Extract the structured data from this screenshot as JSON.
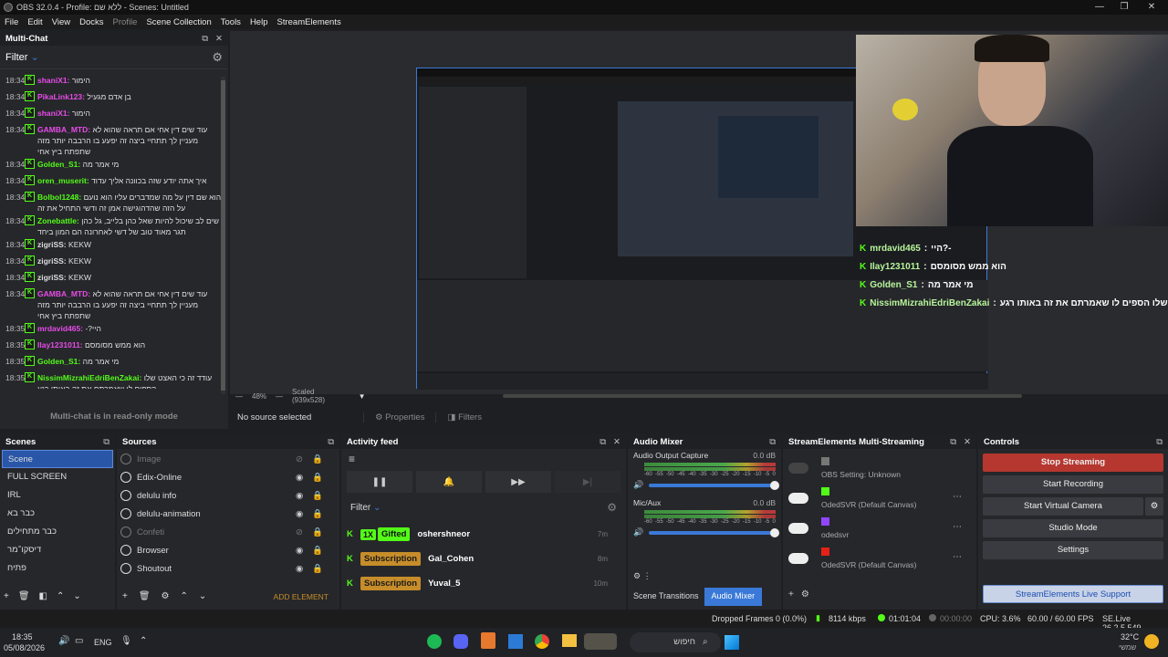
{
  "window": {
    "title": "OBS 32.0.4 - Profile: ללא שם - Scenes: Untitled",
    "min": "—",
    "max": "❐",
    "close": "✕"
  },
  "menu": [
    "File",
    "Edit",
    "View",
    "Docks",
    "Profile",
    "Scene Collection",
    "Tools",
    "Help",
    "StreamElements"
  ],
  "multichat": {
    "title": "Multi-Chat",
    "filter": "Filter",
    "readonly": "Multi-chat is in read-only mode",
    "messages": [
      {
        "time": "18:34",
        "user": "shaniX1:",
        "color": "#e64ce6",
        "text": "הימור"
      },
      {
        "time": "18:34",
        "user": "PikaLink123:",
        "color": "#e64ce6",
        "text": "בן אדם מגעיל"
      },
      {
        "time": "18:34",
        "user": "shaniX1:",
        "color": "#e64ce6",
        "text": "הימור"
      },
      {
        "time": "18:34",
        "user": "GAMBA_MTD:",
        "color": "#e64ce6",
        "text": "עוד שים דין אחי אם תראה שהוא לא מעניין לך תתחיי ביצה זה יפעע בו הרבבה יותר מזה שתפתח ביץ אחי"
      },
      {
        "time": "18:34",
        "user": "Golden_S1:",
        "color": "#53fc18",
        "text": "מי אמר מה"
      },
      {
        "time": "18:34",
        "user": "oren_muserit:",
        "color": "#53fc18",
        "text": "איך אתה יודע שזה בכוונה אליך עדוד"
      },
      {
        "time": "18:34",
        "user": "Bolbol1248:",
        "color": "#53fc18",
        "text": "הוא שם דין על מה שמדברים עליו הוא נועם על הזה שהדהוגישה אמן זה ודשי התחיל את זה"
      },
      {
        "time": "18:34",
        "user": "Zonebattle:",
        "color": "#53fc18",
        "text": "שים לב שיכול להיות שאל כהן בלייב, גל כהן תגר מאוד טוב של דשי לאחרונה הם המון ביחד"
      },
      {
        "time": "18:34",
        "user": "zigriSS:",
        "color": "#dddddd",
        "text": "KEKW"
      },
      {
        "time": "18:34",
        "user": "zigriSS:",
        "color": "#dddddd",
        "text": "KEKW"
      },
      {
        "time": "18:34",
        "user": "zigriSS:",
        "color": "#dddddd",
        "text": "KEKW"
      },
      {
        "time": "18:34",
        "user": "GAMBA_MTD:",
        "color": "#e64ce6",
        "text": "עוד שים דין אחי אם תראה שהוא לא מעניין לך תתחיי ביצה זה יפעע בו הרבבה יותר מזה שתפתח ביץ אחי"
      },
      {
        "time": "18:35",
        "user": "mrdavid465:",
        "color": "#e64ce6",
        "text": "היי?-"
      },
      {
        "time": "18:35",
        "user": "Ilay1231011:",
        "color": "#e64ce6",
        "text": "הוא ממש מסומסם"
      },
      {
        "time": "18:35",
        "user": "Golden_S1:",
        "color": "#53fc18",
        "text": "מי אמר מה"
      },
      {
        "time": "18:35",
        "user": "NissimMizrahiEdriBenZakai:",
        "color": "#53fc18",
        "text": "עודד זה כי האצט שלו הספים לו שאמרתם את זה באותו רגע"
      }
    ]
  },
  "preview": {
    "zoom": "48%",
    "scaled": "Scaled (939x528)"
  },
  "overlay_chat": [
    {
      "user": "mrdavid465",
      "text": "היי?-"
    },
    {
      "user": "Ilay1231011",
      "text": "הוא ממש מסומסם"
    },
    {
      "user": "Golden_S1",
      "text": "מי אמר מה"
    },
    {
      "user": "NissimMizrahiEdriBenZakai",
      "text": "עודד זה כי הפיס שלו הספים לו שאמרתם את זה באותו רגע"
    }
  ],
  "source_bar": {
    "none": "No source selected",
    "properties": "Properties",
    "filters": "Filters"
  },
  "scenes": {
    "title": "Scenes",
    "items": [
      "Scene",
      "FULL SCREEN",
      "IRL",
      "כבר בא",
      "כבר מתחילים",
      "דיסקו־מר",
      "פתיח"
    ]
  },
  "sources": {
    "title": "Sources",
    "items": [
      {
        "name": "Image",
        "dim": true
      },
      {
        "name": "Edix-Online",
        "dim": false
      },
      {
        "name": "delulu info",
        "dim": false
      },
      {
        "name": "delulu-animation",
        "dim": false
      },
      {
        "name": "Confeti",
        "dim": true
      },
      {
        "name": "Browser",
        "dim": false
      },
      {
        "name": "Shoutout",
        "dim": false
      }
    ],
    "add_element": "ADD ELEMENT"
  },
  "activity": {
    "title": "Activity feed",
    "filter": "Filter",
    "rows": [
      {
        "badge": "1X",
        "tag": "Gifted",
        "user": "oshershneor",
        "ago": "7m"
      },
      {
        "badge": "",
        "tag": "Subscription",
        "user": "Gal_Cohen",
        "ago": "8m"
      },
      {
        "badge": "",
        "tag": "Subscription",
        "user": "Yuval_5",
        "ago": "10m"
      }
    ]
  },
  "mixer": {
    "title": "Audio Mixer",
    "channels": [
      {
        "name": "Audio Output Capture",
        "db": "0.0 dB"
      },
      {
        "name": "Mic/Aux",
        "db": "0.0 dB"
      }
    ],
    "scale": [
      "-60",
      "-55",
      "-50",
      "-45",
      "-40",
      "-35",
      "-30",
      "-25",
      "-20",
      "-15",
      "-10",
      "-5",
      "0"
    ],
    "tab1": "Scene Transitions",
    "tab2": "Audio Mixer"
  },
  "se_multi": {
    "title": "StreamElements Multi-Streaming",
    "rows": [
      {
        "label": "OBS Setting: Unknown"
      },
      {
        "label": "OdedSVR (Default Canvas)"
      },
      {
        "label": "odedsvr"
      },
      {
        "label": "OdedSVR (Default Canvas)"
      }
    ]
  },
  "controls": {
    "title": "Controls",
    "stop": "Stop Streaming",
    "record": "Start Recording",
    "vcam": "Start Virtual Camera",
    "studio": "Studio Mode",
    "settings": "Settings",
    "support": "StreamElements Live Support"
  },
  "status": {
    "dropped": "Dropped Frames 0 (0.0%)",
    "kbps": "8114 kbps",
    "live": "01:01:04",
    "rec": "00:00:00",
    "cpu": "CPU: 3.6%",
    "fps": "60.00 / 60.00 FPS",
    "ver": "SE.Live 26.2.5.549"
  },
  "taskbar": {
    "time": "18:35",
    "date": "05/08/2026",
    "lang": "ENG",
    "search": "חיפוש",
    "temp": "32°C",
    "weather": "שמשי"
  },
  "colors": {
    "green": "#53fc18",
    "stop": "#b5372f",
    "accent": "#3a79d8"
  }
}
